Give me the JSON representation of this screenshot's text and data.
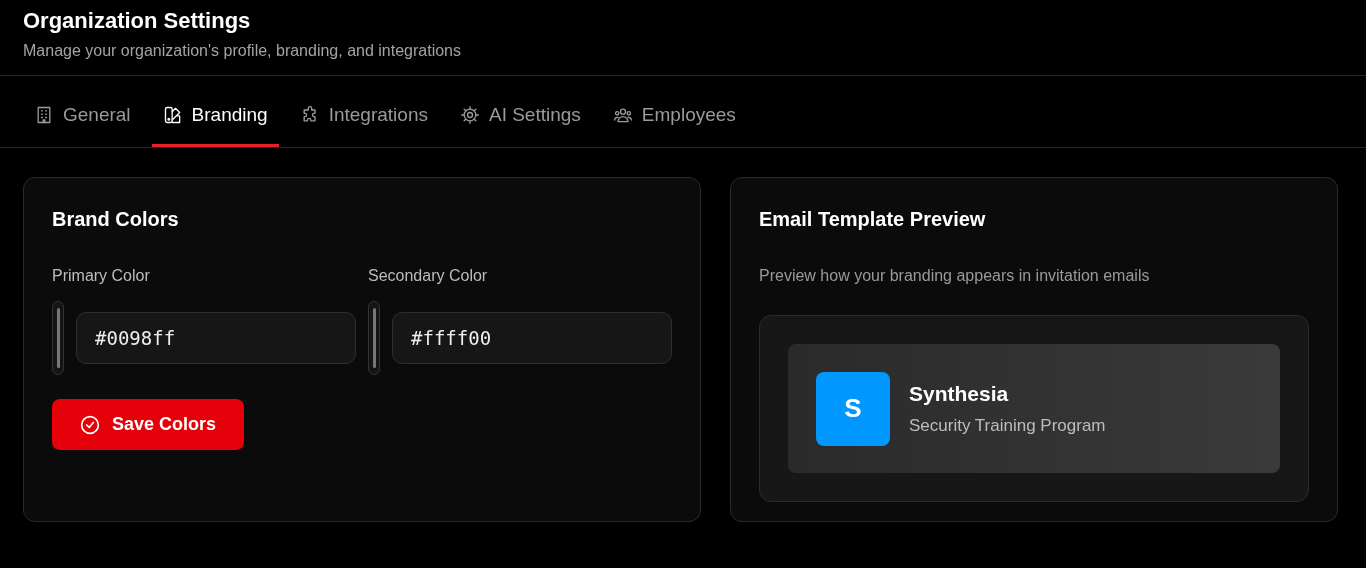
{
  "header": {
    "title": "Organization Settings",
    "subtitle": "Manage your organization's profile, branding, and integrations"
  },
  "tabs": [
    {
      "label": "General",
      "selected": false
    },
    {
      "label": "Branding",
      "selected": true
    },
    {
      "label": "Integrations",
      "selected": false
    },
    {
      "label": "AI Settings",
      "selected": false
    },
    {
      "label": "Employees",
      "selected": false
    }
  ],
  "brand_colors": {
    "title": "Brand Colors",
    "fields": [
      {
        "label": "Primary Color",
        "value": "#0098ff"
      },
      {
        "label": "Secondary Color",
        "value": "#ffff00"
      }
    ],
    "save_button": "Save Colors"
  },
  "email_preview": {
    "title": "Email Template Preview",
    "description": "Preview how your branding appears in invitation emails",
    "logo": {
      "letter": "S",
      "color": "#0098ff"
    },
    "name": "Synthesia",
    "tagline": "Security Training Program"
  }
}
